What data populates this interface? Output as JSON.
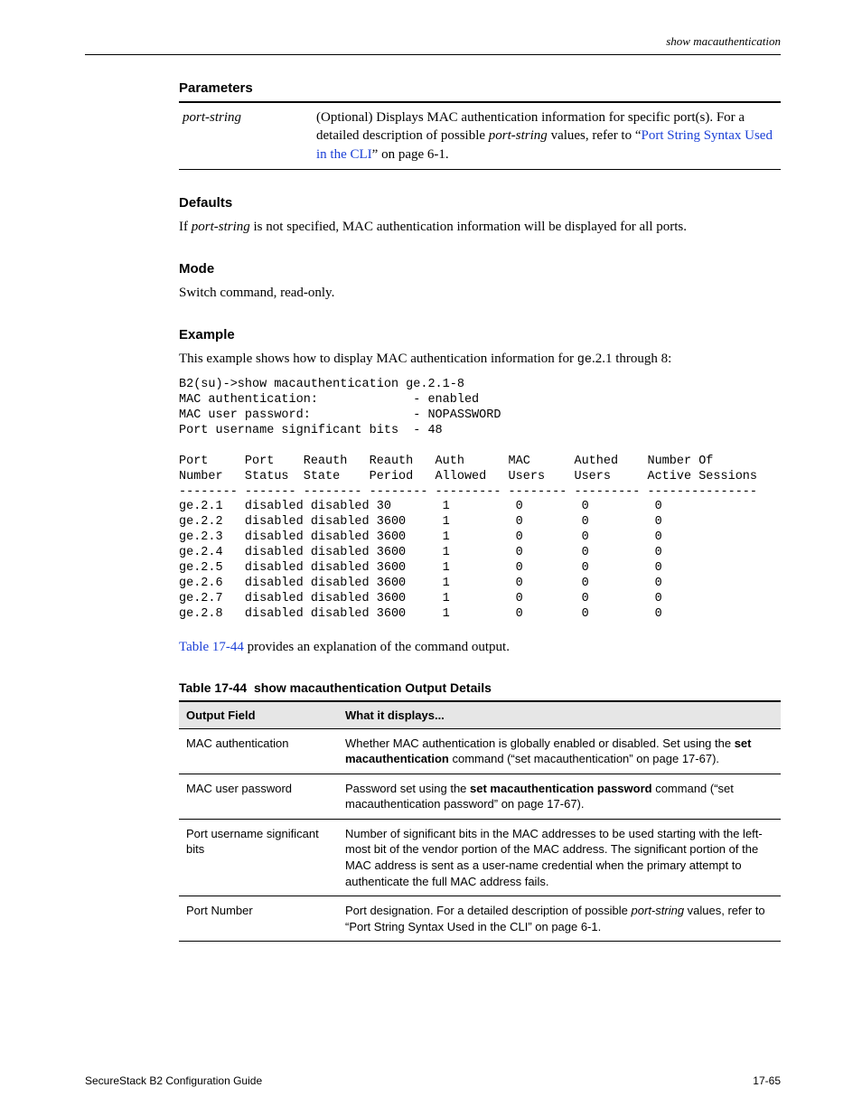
{
  "running_head": "show macauthentication",
  "sections": {
    "parameters": {
      "heading": "Parameters",
      "row": {
        "name": "port-string",
        "desc_pre": "(Optional) Displays MAC authentication information for specific port(s). For a detailed description of possible ",
        "desc_ital": "port-string",
        "desc_mid": " values, refer to “",
        "desc_link": "Port String Syntax Used in the CLI",
        "desc_post": "” on page 6-1."
      }
    },
    "defaults": {
      "heading": "Defaults",
      "text_pre": "If ",
      "text_ital": "port-string",
      "text_post": " is not specified, MAC authentication information will be displayed for all ports."
    },
    "mode": {
      "heading": "Mode",
      "text": "Switch command, read-only."
    },
    "example": {
      "heading": "Example",
      "intro_pre": "This example shows how to display MAC authentication information for ",
      "intro_mono": "ge",
      "intro_post": ".2.1 through 8:",
      "cli": "B2(su)->show macauthentication ge.2.1-8\nMAC authentication:             - enabled\nMAC user password:              - NOPASSWORD\nPort username significant bits  - 48\n\nPort     Port    Reauth   Reauth   Auth      MAC      Authed    Number Of\nNumber   Status  State    Period   Allowed   Users    Users     Active Sessions\n-------- ------- -------- -------- --------- -------- --------- ---------------\nge.2.1   disabled disabled 30       1         0        0         0\nge.2.2   disabled disabled 3600     1         0        0         0\nge.2.3   disabled disabled 3600     1         0        0         0\nge.2.4   disabled disabled 3600     1         0        0         0\nge.2.5   disabled disabled 3600     1         0        0         0\nge.2.6   disabled disabled 3600     1         0        0         0\nge.2.7   disabled disabled 3600     1         0        0         0\nge.2.8   disabled disabled 3600     1         0        0         0"
    },
    "outro": {
      "link": "Table 17-44",
      "text": " provides an explanation of the command output."
    }
  },
  "table": {
    "caption_label": "Table 17-44",
    "caption_text": "show macauthentication Output Details",
    "head_field": "Output Field",
    "head_desc": "What it displays...",
    "rows": [
      {
        "k": "MAC authentication",
        "v_pre": "Whether MAC authentication is globally enabled or disabled. Set using the ",
        "v_bold": "set macauthentication",
        "v_post": " command (“set macauthentication” on page 17-67)."
      },
      {
        "k": "MAC user password",
        "v_pre": "Password set using the ",
        "v_bold": "set macauthentication password",
        "v_post": " command (“set macauthentication password” on page 17-67)."
      },
      {
        "k": "Port username significant bits",
        "v_pre": "Number of significant bits in the MAC addresses to be used starting with the left-most bit of the vendor portion of the MAC address. The significant portion of the MAC address is sent as a user-name credential when the primary attempt to authenticate the full MAC address fails. ",
        "v_bold": "",
        "v_post": ""
      },
      {
        "k": "Port Number",
        "v_pre": "Port designation. For a detailed description of possible ",
        "v_ital": "port-string",
        "v_post2": " values, refer to “Port String Syntax Used in the CLI” on page 6-1.",
        "v_bold": "",
        "v_post": ""
      }
    ]
  },
  "footer": {
    "left": "SecureStack B2 Configuration Guide",
    "right": "17-65"
  }
}
